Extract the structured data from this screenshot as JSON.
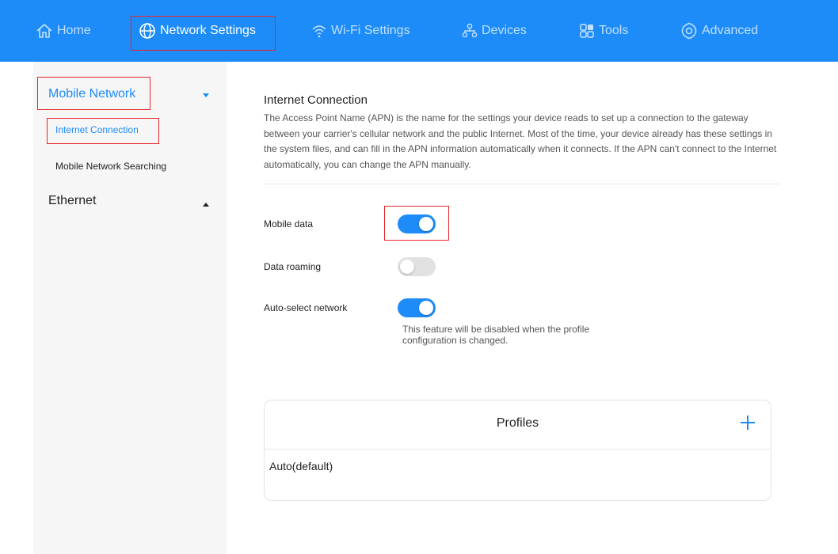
{
  "nav": {
    "home": "Home",
    "network_settings": "Network Settings",
    "wifi_settings": "Wi-Fi Settings",
    "devices": "Devices",
    "tools": "Tools",
    "advanced": "Advanced",
    "active": "Network Settings"
  },
  "sidebar": {
    "mobile_network": "Mobile Network",
    "internet_connection": "Internet Connection",
    "mobile_network_searching": "Mobile Network Searching",
    "ethernet": "Ethernet"
  },
  "main": {
    "title": "Internet Connection",
    "description": "The Access Point Name (APN) is the name for the settings your device reads to set up a connection to the gateway between your carrier's cellular network and the public Internet. Most of the time, your device already has these settings in the system files, and can fill in the APN information automatically when it connects. If the APN can't connect to the Internet automatically, you can change the APN manually.",
    "mobile_data_label": "Mobile data",
    "mobile_data_on": true,
    "data_roaming_label": "Data roaming",
    "data_roaming_on": false,
    "auto_select_label": "Auto-select network",
    "auto_select_on": true,
    "auto_select_hint": "This feature will be disabled when the profile configuration is changed."
  },
  "profiles": {
    "title": "Profiles",
    "items": [
      "Auto(default)"
    ]
  },
  "colors": {
    "accent": "#1d8cf8",
    "highlight": "#e8262b",
    "sidebar_bg": "#f6f6f6"
  },
  "icons": [
    "home-icon",
    "globe-icon",
    "wifi-icon",
    "devices-icon",
    "tools-icon",
    "gear-icon",
    "plus-icon"
  ]
}
